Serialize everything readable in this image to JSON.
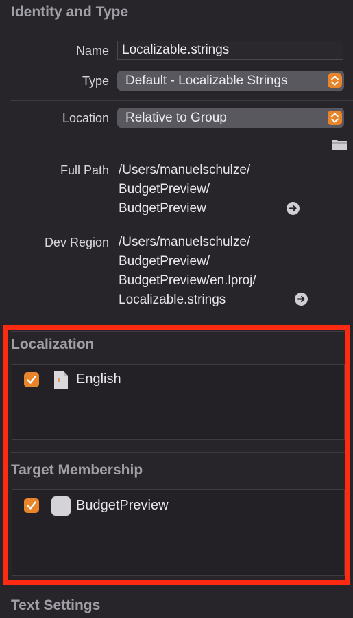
{
  "identity": {
    "title": "Identity and Type",
    "name_label": "Name",
    "name_value": "Localizable.strings",
    "type_label": "Type",
    "type_value": "Default - Localizable Strings",
    "location_label": "Location",
    "location_value": "Relative to Group",
    "full_path_label": "Full Path",
    "full_path_lines": [
      "/Users/manuelschulze/",
      "BudgetPreview/",
      "BudgetPreview"
    ],
    "dev_region_label": "Dev Region",
    "dev_region_lines": [
      "/Users/manuelschulze/",
      "BudgetPreview/",
      "BudgetPreview/en.lproj/",
      "Localizable.strings"
    ]
  },
  "localization": {
    "title": "Localization",
    "items": [
      {
        "label": "English",
        "checked": true
      }
    ]
  },
  "target_membership": {
    "title": "Target Membership",
    "items": [
      {
        "label": "BudgetPreview",
        "checked": true
      }
    ]
  },
  "text_settings": {
    "title": "Text Settings"
  },
  "colors": {
    "accent": "#e8852b",
    "highlight_frame": "#ff2a12",
    "background": "#27252a"
  },
  "icons": [
    "folder-icon",
    "reveal-arrow-icon",
    "document-icon",
    "target-app-icon",
    "checkmark-icon"
  ]
}
